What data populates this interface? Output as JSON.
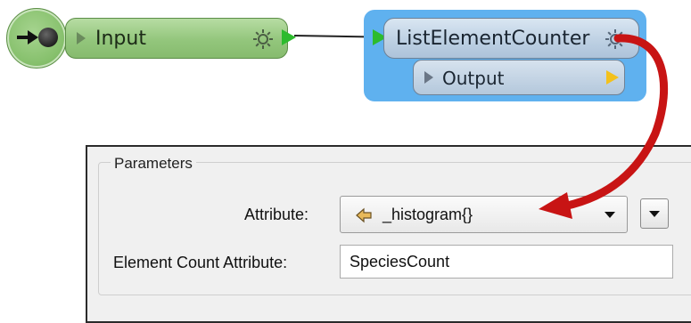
{
  "workspace": {
    "input_node": {
      "label": "Input"
    },
    "transformer": {
      "label": "ListElementCounter",
      "output_port": {
        "label": "Output"
      }
    }
  },
  "parameters": {
    "group_title": "Parameters",
    "attribute": {
      "label": "Attribute:",
      "value": "_histogram{}"
    },
    "element_count_attribute": {
      "label": "Element Count Attribute:",
      "value": "SpeciesCount"
    }
  },
  "icons": {
    "reader": "reader-arrow-dot-icon",
    "gear": "gear-icon",
    "port_in": "green-triangle-icon",
    "port_out": "yellow-triangle-icon",
    "attribute": "attribute-arrow-icon",
    "dropdown": "chevron-down-icon",
    "callout": "red-curved-arrow-icon"
  },
  "colors": {
    "input_node": "#93c67c",
    "selection_highlight": "#5fb1ef",
    "transformer_node": "#bccfe2",
    "port_green": "#2dbb2d",
    "port_yellow": "#f3c11c",
    "callout_arrow": "#c81414"
  }
}
